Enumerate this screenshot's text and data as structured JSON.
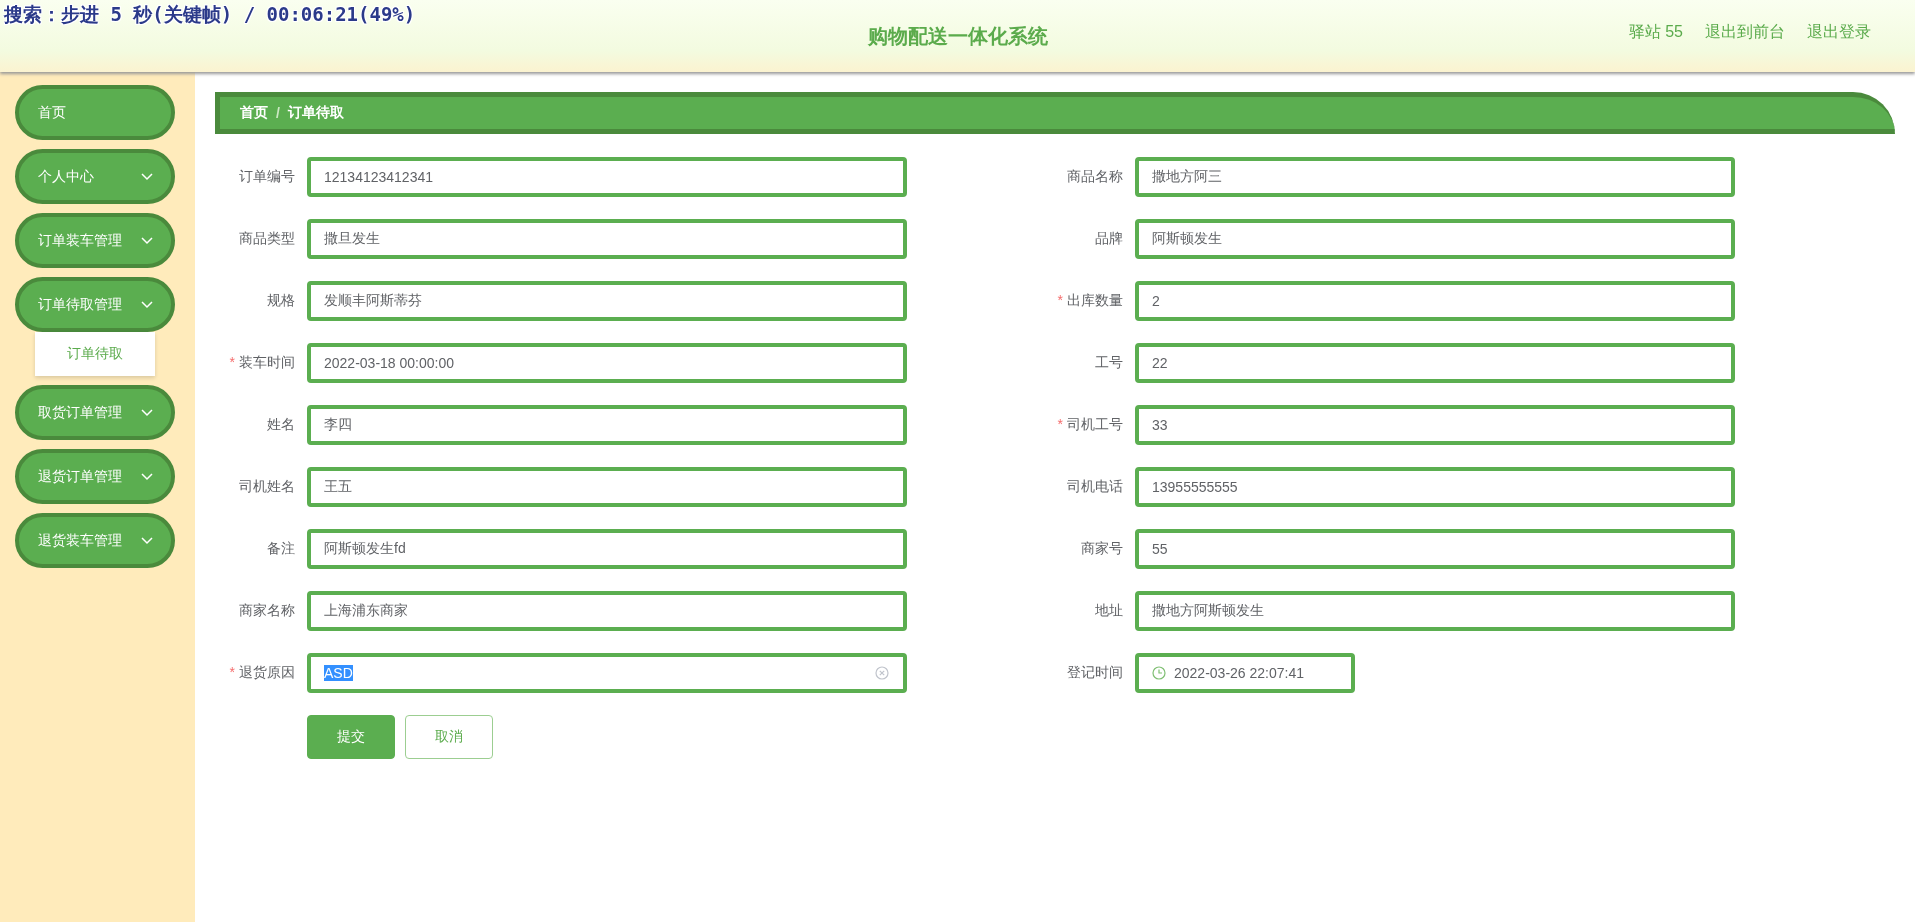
{
  "overlay": {
    "text": "搜索：步进 5 秒(关键帧) / 00:06:21(49%)"
  },
  "header": {
    "title": "购物配送一体化系统",
    "links": [
      "驿站 55",
      "退出到前台",
      "退出登录"
    ]
  },
  "sidebar": {
    "items": [
      {
        "kind": "link",
        "label": "首页"
      },
      {
        "kind": "submenu",
        "label": "个人中心"
      },
      {
        "kind": "submenu",
        "label": "订单装车管理"
      },
      {
        "kind": "submenu",
        "label": "订单待取管理",
        "children": [
          {
            "label": "订单待取",
            "selected": true
          }
        ]
      },
      {
        "kind": "submenu",
        "label": "取货订单管理"
      },
      {
        "kind": "submenu",
        "label": "退货订单管理"
      },
      {
        "kind": "submenu",
        "label": "退货装车管理"
      }
    ]
  },
  "breadcrumb": {
    "items": [
      "首页",
      "订单待取"
    ],
    "separator": "/"
  },
  "form": {
    "rows": [
      [
        {
          "label": "订单编号",
          "value": "12134123412341",
          "kind": "text"
        },
        {
          "label": "商品名称",
          "value": "撒地方阿三",
          "kind": "text"
        }
      ],
      [
        {
          "label": "商品类型",
          "value": "撒旦发生",
          "kind": "text"
        },
        {
          "label": "品牌",
          "value": "阿斯顿发生",
          "kind": "text"
        }
      ],
      [
        {
          "label": "规格",
          "value": "发顺丰阿斯蒂芬",
          "kind": "text"
        },
        {
          "label": "出库数量",
          "value": "2",
          "required_mark": "*",
          "kind": "text"
        }
      ],
      [
        {
          "label": "装车时间",
          "value": "2022-03-18 00:00:00",
          "required_mark": "*",
          "kind": "text"
        },
        {
          "label": "工号",
          "value": "22",
          "kind": "text"
        }
      ],
      [
        {
          "label": "姓名",
          "value": "李四",
          "kind": "text"
        },
        {
          "label": "司机工号",
          "value": "33",
          "required_mark": "*",
          "kind": "text"
        }
      ],
      [
        {
          "label": "司机姓名",
          "value": "王五",
          "kind": "text"
        },
        {
          "label": "司机电话",
          "value": "13955555555",
          "kind": "text"
        }
      ],
      [
        {
          "label": "备注",
          "value": "阿斯顿发生fd",
          "kind": "text"
        },
        {
          "label": "商家号",
          "value": "55",
          "kind": "text"
        }
      ],
      [
        {
          "label": "商家名称",
          "value": "上海浦东商家",
          "kind": "text"
        },
        {
          "label": "地址",
          "value": "撒地方阿斯顿发生",
          "kind": "text"
        }
      ],
      [
        {
          "label": "退货原因",
          "value": "ASD",
          "required_mark": "*",
          "kind": "clearable",
          "text_selected": true
        },
        {
          "label": "登记时间",
          "value": "2022-03-26 22:07:41",
          "kind": "datetime"
        }
      ]
    ],
    "buttons": [
      {
        "label": "提交",
        "kind": "primary"
      },
      {
        "label": "取消",
        "kind": "plain"
      }
    ]
  }
}
